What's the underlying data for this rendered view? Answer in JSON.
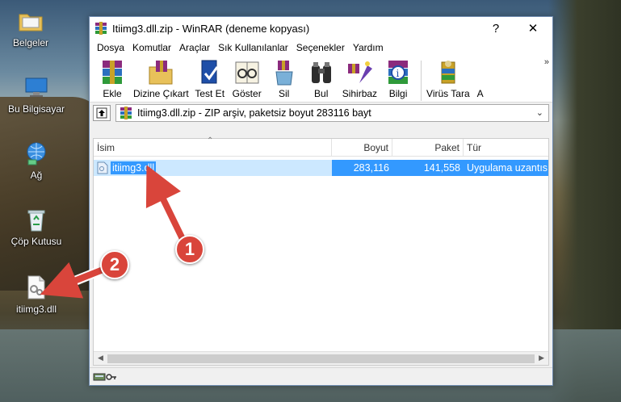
{
  "desktop": {
    "icons": [
      {
        "label": "Belgeler",
        "icon": "folder-documents-icon"
      },
      {
        "label": "Bu Bilgisayar",
        "icon": "computer-icon"
      },
      {
        "label": "Ağ",
        "icon": "network-icon"
      },
      {
        "label": "Çöp Kutusu",
        "icon": "recycle-bin-icon"
      },
      {
        "label": "itiimg3.dll",
        "icon": "dll-file-icon"
      }
    ]
  },
  "window": {
    "title": "Itiimg3.dll.zip - WinRAR (deneme kopyası)",
    "help_label": "?",
    "close_label": "✕"
  },
  "menu": [
    "Dosya",
    "Komutlar",
    "Araçlar",
    "Sık Kullanılanlar",
    "Seçenekler",
    "Yardım"
  ],
  "toolbar": {
    "buttons": [
      {
        "label": "Ekle",
        "icon": "add-archive-icon"
      },
      {
        "label": "Dizine Çıkart",
        "icon": "extract-to-icon"
      },
      {
        "label": "Test Et",
        "icon": "test-icon"
      },
      {
        "label": "Göster",
        "icon": "view-icon"
      },
      {
        "label": "Sil",
        "icon": "delete-icon"
      },
      {
        "label": "Bul",
        "icon": "find-icon"
      },
      {
        "label": "Sihirbaz",
        "icon": "wizard-icon"
      },
      {
        "label": "Bilgi",
        "icon": "info-icon"
      },
      {
        "label": "Virüs Tara",
        "icon": "virus-scan-icon"
      },
      {
        "label": "A",
        "icon": "comment-icon"
      }
    ],
    "more": "»"
  },
  "address": {
    "text": "Itiimg3.dll.zip - ZIP arşiv, paketsiz boyut 283116 bayt"
  },
  "list": {
    "columns": {
      "name": "İsim",
      "size": "Boyut",
      "packed": "Paket",
      "type": "Tür"
    },
    "rows": [
      {
        "name": "itiimg3.dll",
        "size": "283,116",
        "packed": "141,558",
        "type": "Uygulama uzantısı"
      }
    ]
  },
  "annotations": {
    "badge1": "1",
    "badge2": "2"
  },
  "colors": {
    "selection": "#3399ff",
    "badge": "#d9453b"
  }
}
